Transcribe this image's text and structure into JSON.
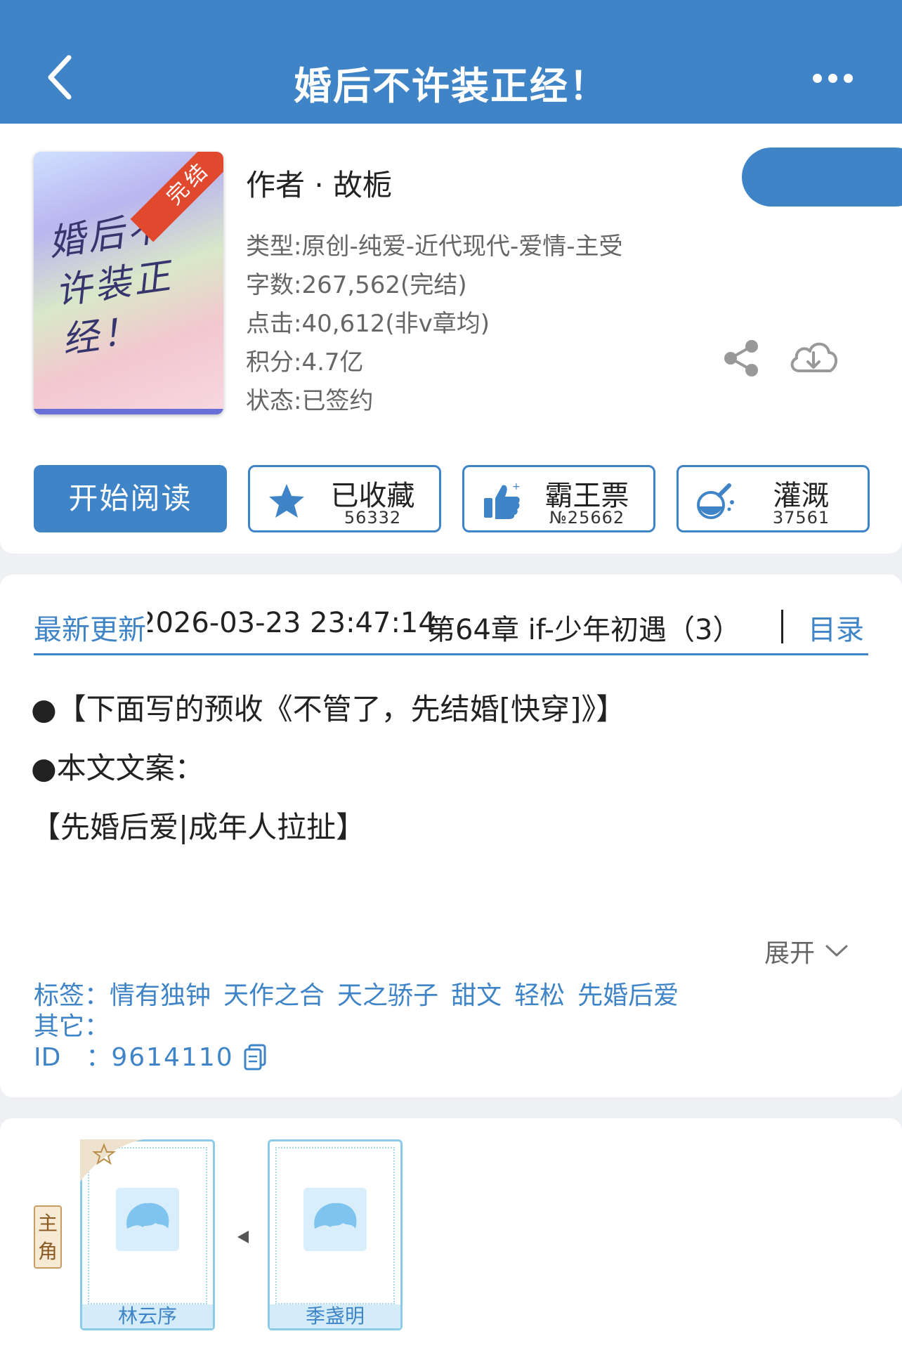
{
  "header": {
    "title": "婚后不许装正经！"
  },
  "book": {
    "cover_title": "婚后不许装正经！",
    "cover_ribbon": "完结",
    "author": "作者 · 故栀",
    "meta": [
      "类型:原创-纯爱-近代现代-爱情-主受",
      "字数:267,562(完结)",
      "点击:40,612(非v章均)",
      "积分:4.7亿",
      "状态:已签约"
    ]
  },
  "actions": {
    "read_label": "开始阅读",
    "buttons": [
      {
        "label": "已收藏",
        "count": "56332",
        "icon": "star-icon"
      },
      {
        "label": "霸王票",
        "count": "№25662",
        "icon": "thumbs-up-icon"
      },
      {
        "label": "灌溉",
        "count": "37561",
        "icon": "nutrient-flask-icon"
      }
    ]
  },
  "update": {
    "label": "最新更新",
    "time": "2026-03-23 23:47:14",
    "chapter": "第64章 if-少年初遇（3）",
    "catalog": "目录"
  },
  "intro": {
    "lines": [
      "●【下面写的预收《不管了，先结婚[快穿]》】",
      "●本文文案：",
      "【先婚后爱|成年人拉扯】"
    ],
    "expand_label": "展开"
  },
  "tags": {
    "label": "标签：",
    "items": [
      "情有独钟",
      "天作之合",
      "天之骄子",
      "甜文",
      "轻松",
      "先婚后爱"
    ],
    "other_label": "其它：",
    "id_label": "ID　：",
    "id_value": "9614110"
  },
  "characters": {
    "role_label": "主角",
    "items": [
      {
        "name": "林云序"
      },
      {
        "name": "季盏明"
      }
    ]
  },
  "colors": {
    "accent": "#3f84c7",
    "ribbon": "#e0492e",
    "badge": "#c89b62"
  }
}
